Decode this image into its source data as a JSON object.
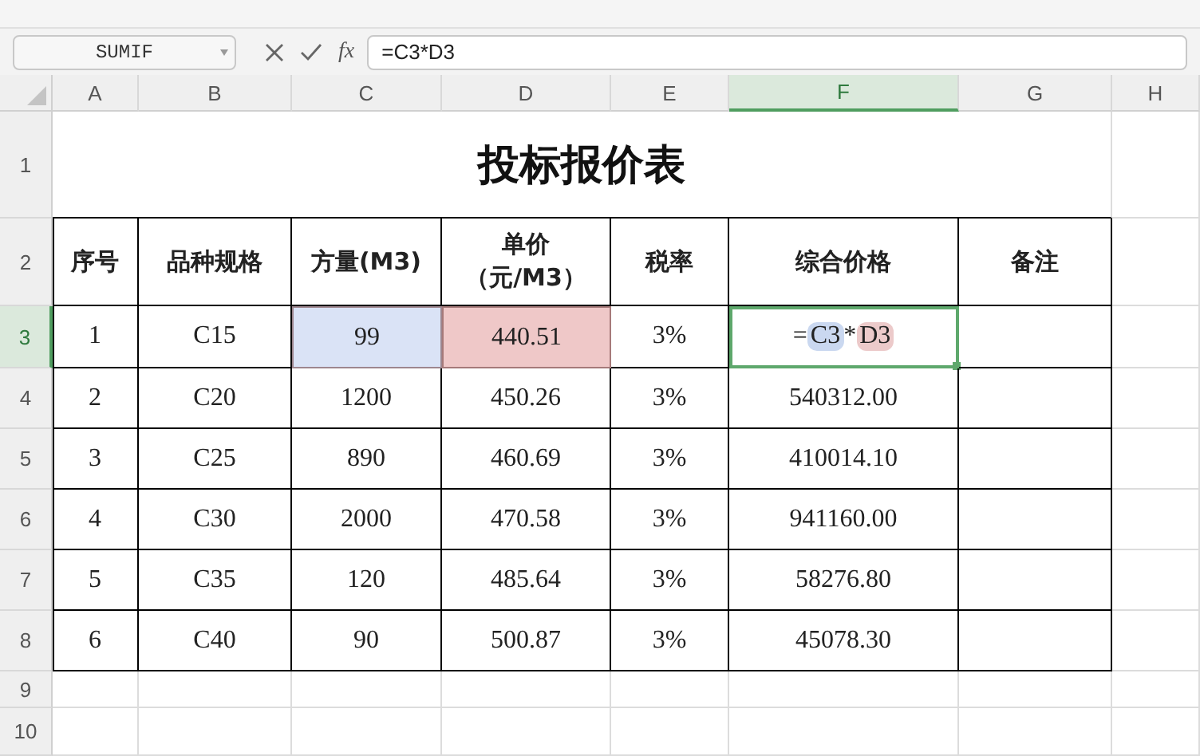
{
  "formula_bar": {
    "name_box": "SUMIF",
    "fx": "fx",
    "formula": "=C3*D3"
  },
  "columns": [
    {
      "label": "A",
      "selected": false
    },
    {
      "label": "B",
      "selected": false
    },
    {
      "label": "C",
      "selected": false
    },
    {
      "label": "D",
      "selected": false
    },
    {
      "label": "E",
      "selected": false
    },
    {
      "label": "F",
      "selected": true
    },
    {
      "label": "G",
      "selected": false
    },
    {
      "label": "H",
      "selected": false
    }
  ],
  "rows": [
    {
      "number": "1",
      "selected": false,
      "cells": [
        {
          "kind": "title",
          "text": "投标报价表",
          "selected": false
        }
      ]
    },
    {
      "number": "2",
      "selected": false,
      "cells": [
        {
          "kind": "header",
          "text": "序号",
          "selected": false
        },
        {
          "kind": "header",
          "text": "品种规格",
          "selected": false
        },
        {
          "kind": "header",
          "text": "方量(M3)",
          "selected": false
        },
        {
          "kind": "header",
          "lines": [
            "单价",
            "（元/M3）"
          ],
          "selected": false
        },
        {
          "kind": "header",
          "text": "税率",
          "selected": false
        },
        {
          "kind": "header",
          "text": "综合价格",
          "selected": false
        },
        {
          "kind": "header",
          "text": "备注",
          "selected": false
        }
      ]
    },
    {
      "number": "3",
      "selected": true,
      "cells": [
        {
          "kind": "text",
          "text": "1",
          "selected": false
        },
        {
          "kind": "text",
          "text": "C15",
          "selected": false
        },
        {
          "kind": "text",
          "text": "99",
          "selected": false,
          "color": "#dae3f6"
        },
        {
          "kind": "text",
          "text": "440.51",
          "selected": false,
          "color": "#efc8c8"
        },
        {
          "kind": "text",
          "text": "3%",
          "selected": false
        },
        {
          "kind": "editing",
          "selected": true,
          "parts": [
            {
              "text": "="
            },
            {
              "text": "C3",
              "color": "#cad8f0"
            },
            {
              "text": "*"
            },
            {
              "text": "D3",
              "color": "#eccaca"
            }
          ]
        }
      ]
    },
    {
      "number": "4",
      "selected": false,
      "cells": [
        {
          "kind": "text",
          "text": "2",
          "selected": false
        },
        {
          "kind": "text",
          "text": "C20",
          "selected": false
        },
        {
          "kind": "text",
          "text": "1200",
          "selected": false
        },
        {
          "kind": "text",
          "text": "450.26",
          "selected": false
        },
        {
          "kind": "text",
          "text": "3%",
          "selected": false
        },
        {
          "kind": "text",
          "text": "540312.00",
          "selected": false
        }
      ]
    },
    {
      "number": "5",
      "selected": false,
      "cells": [
        {
          "kind": "text",
          "text": "3",
          "selected": false
        },
        {
          "kind": "text",
          "text": "C25",
          "selected": false
        },
        {
          "kind": "text",
          "text": "890",
          "selected": false
        },
        {
          "kind": "text",
          "text": "460.69",
          "selected": false
        },
        {
          "kind": "text",
          "text": "3%",
          "selected": false
        },
        {
          "kind": "text",
          "text": "410014.10",
          "selected": false
        }
      ]
    },
    {
      "number": "6",
      "selected": false,
      "cells": [
        {
          "kind": "text",
          "text": "4",
          "selected": false
        },
        {
          "kind": "text",
          "text": "C30",
          "selected": false
        },
        {
          "kind": "text",
          "text": "2000",
          "selected": false
        },
        {
          "kind": "text",
          "text": "470.58",
          "selected": false
        },
        {
          "kind": "text",
          "text": "3%",
          "selected": false
        },
        {
          "kind": "text",
          "text": "941160.00",
          "selected": false
        }
      ]
    },
    {
      "number": "7",
      "selected": false,
      "cells": [
        {
          "kind": "text",
          "text": "5",
          "selected": false
        },
        {
          "kind": "text",
          "text": "C35",
          "selected": false
        },
        {
          "kind": "text",
          "text": "120",
          "selected": false
        },
        {
          "kind": "text",
          "text": "485.64",
          "selected": false
        },
        {
          "kind": "text",
          "text": "3%",
          "selected": false
        },
        {
          "kind": "text",
          "text": "58276.80",
          "selected": false
        }
      ]
    },
    {
      "number": "8",
      "selected": false,
      "cells": [
        {
          "kind": "text",
          "text": "6",
          "selected": false
        },
        {
          "kind": "text",
          "text": "C40",
          "selected": false
        },
        {
          "kind": "text",
          "text": "90",
          "selected": false
        },
        {
          "kind": "text",
          "text": "500.87",
          "selected": false
        },
        {
          "kind": "text",
          "text": "3%",
          "selected": false
        },
        {
          "kind": "text",
          "text": "45078.30",
          "selected": false
        }
      ]
    },
    {
      "number": "9",
      "selected": false,
      "cells": []
    },
    {
      "number": "10",
      "selected": false,
      "cells": []
    }
  ]
}
